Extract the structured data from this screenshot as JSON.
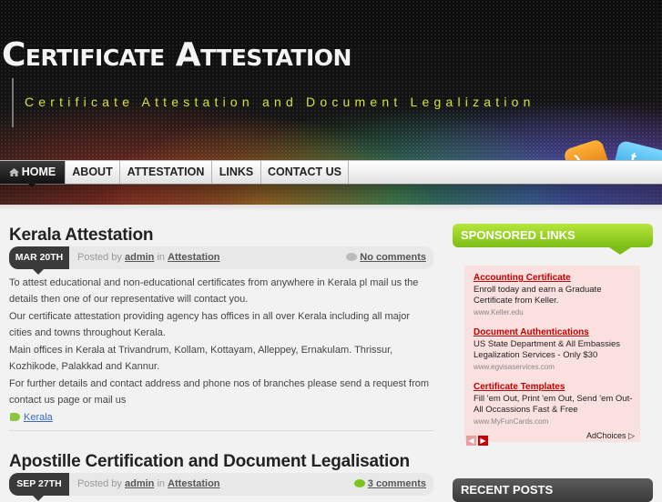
{
  "site": {
    "title": "Certificate Attestation",
    "tagline": "Certificate Attestation and Document Legalization"
  },
  "social": {
    "rss_icon": "rss-icon",
    "twitter_icon": "twitter-icon"
  },
  "nav": {
    "items": [
      {
        "label": "HOME",
        "active": true,
        "icon": "home-icon"
      },
      {
        "label": "ABOUT"
      },
      {
        "label": "ATTESTATION"
      },
      {
        "label": "LINKS"
      },
      {
        "label": "CONTACT US"
      }
    ]
  },
  "posts": [
    {
      "title": "Kerala Attestation",
      "date": "MAR 20TH",
      "posted_by_prefix": "Posted by",
      "author": "admin",
      "in_word": "in",
      "category": "Attestation",
      "comments": "No comments",
      "paragraphs": [
        "To attest educational and non-educational certificates from anywhere in Kerala pl mail us the details then one of our representative will contact you.",
        "Our certificate attestation providing agency has offices in all over Kerala including all major cities and towns throughout Kerala.",
        "Main offices in Kerala at Trivandrum, Kollam, Kottayam, Alleppey, Ernakulam. Thrissur, Kozhikode, Palakkad and Kannur.",
        "For further details and  contact address and phone nos of branches please send a request from contact us page or mail us"
      ],
      "tag": "Kerala"
    },
    {
      "title": "Apostille Certification and Document Legalisation",
      "date": "SEP 27TH",
      "posted_by_prefix": "Posted by",
      "author": "admin",
      "in_word": "in",
      "category": "Attestation",
      "comments": "3 comments"
    }
  ],
  "sidebar": {
    "sponsored_heading": "SPONSORED LINKS",
    "ads": [
      {
        "title": "Accounting Certificate",
        "desc": "Enroll today and earn a Graduate Certificate from Keller.",
        "url": "www.Keller.edu"
      },
      {
        "title": "Document Authentications",
        "desc": "US State Department & All Embassies Legalization Services - Only $30",
        "url": "www.egvisaservices.com"
      },
      {
        "title": "Certificate Templates",
        "desc": "Fill 'em Out, Print 'em Out, Send 'em Out- All Occassions Fast & Free",
        "url": "www.MyFunCards.com"
      }
    ],
    "adchoices": "AdChoices",
    "recent_heading": "RECENT POSTS"
  },
  "colors": {
    "accent_green": "#8cc63f",
    "ad_red": "#c40000",
    "tagline": "#d4e43a"
  }
}
